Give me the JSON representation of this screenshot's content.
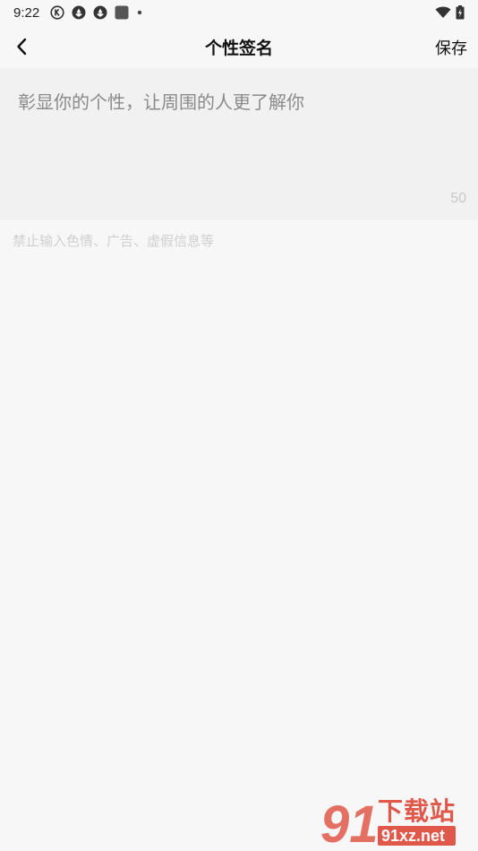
{
  "status_bar": {
    "time": "9:22",
    "icons_left": [
      "k-circle-icon",
      "aperture-icon",
      "aperture-icon",
      "square-app-icon",
      "dot-icon"
    ],
    "icons_right": [
      "wifi-icon",
      "battery-charging-icon"
    ]
  },
  "nav": {
    "back_icon": "chevron-left-icon",
    "title": "个性签名",
    "save_label": "保存"
  },
  "signature": {
    "value": "",
    "placeholder": "彰显你的个性，让周围的人更了解你",
    "remaining": "50"
  },
  "hint": "禁止输入色情、广告、虚假信息等",
  "watermark": {
    "logo_text": "91",
    "cn_text": "下载站",
    "url_text": "91xz.net"
  },
  "colors": {
    "background": "#f7f7f7",
    "input_background": "#f1f1f1",
    "watermark": "#e0584a"
  }
}
